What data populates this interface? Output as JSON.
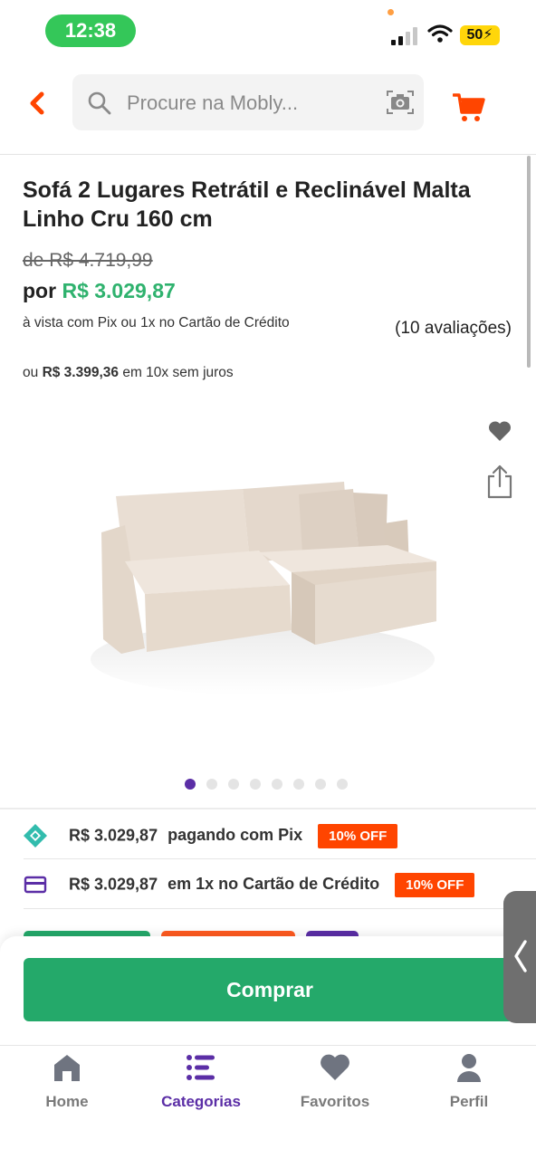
{
  "status_bar": {
    "time": "12:38",
    "battery": "50"
  },
  "header": {
    "search_placeholder": "Procure na Mobly...",
    "icons": [
      "back-icon",
      "search-icon",
      "camera-icon",
      "cart-icon"
    ]
  },
  "product": {
    "title": "Sofá 2 Lugares Retrátil e Reclinável Malta Linho Cru 160 cm",
    "old_price": "de R$ 4.719,99",
    "price_prefix": "por",
    "price": "R$ 3.029,87",
    "pix_note": "à vista com Pix ou 1x no Cartão de Crédito",
    "reviews": "(10 avaliações)",
    "installment_prefix": "ou",
    "installment_amount": "R$ 3.399,36",
    "installment_suffix": "em 10x sem juros"
  },
  "gallery": {
    "image_count": 8,
    "active_index": 0
  },
  "payment_options": [
    {
      "amount": "R$ 3.029,87",
      "method": "pagando com Pix",
      "badge": "10% OFF",
      "icon": "pix-icon"
    },
    {
      "amount": "R$ 3.029,87",
      "method": "em 1x no Cartão de Crédito",
      "badge": "10% OFF",
      "icon": "credit-card-icon"
    }
  ],
  "buy_button": {
    "label": "Comprar"
  },
  "bottom_nav": [
    {
      "label": "Home",
      "icon": "home-icon",
      "active": false
    },
    {
      "label": "Categorias",
      "icon": "list-icon",
      "active": true
    },
    {
      "label": "Favoritos",
      "icon": "heart-icon",
      "active": false
    },
    {
      "label": "Perfil",
      "icon": "user-icon",
      "active": false
    }
  ],
  "colors": {
    "accent_orange": "#ff4500",
    "price_green": "#2fb26e",
    "buy_green": "#24a96a",
    "nav_active_purple": "#5b2ea6",
    "status_green": "#34c759"
  }
}
